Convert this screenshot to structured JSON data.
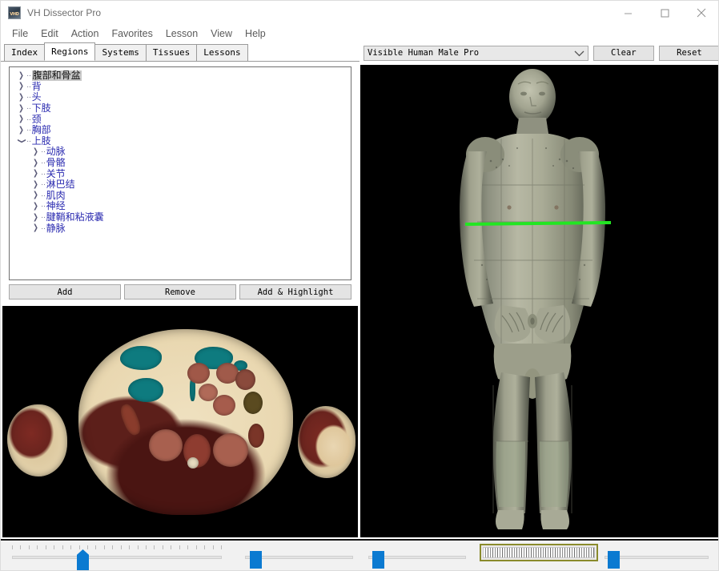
{
  "window": {
    "title": "VH Dissector Pro",
    "icon": "app-icon",
    "controls": {
      "minimize": "minimize-icon",
      "maximize": "maximize-icon",
      "close": "close-icon"
    }
  },
  "menubar": {
    "items": [
      {
        "label": "File"
      },
      {
        "label": "Edit"
      },
      {
        "label": "Action"
      },
      {
        "label": "Favorites"
      },
      {
        "label": "Lesson"
      },
      {
        "label": "View"
      },
      {
        "label": "Help"
      }
    ]
  },
  "tabs": {
    "active": "Regions",
    "items": [
      {
        "label": "Index"
      },
      {
        "label": "Regions"
      },
      {
        "label": "Systems"
      },
      {
        "label": "Tissues"
      },
      {
        "label": "Lessons"
      }
    ]
  },
  "tree": {
    "nodes": [
      {
        "label": "腹部和骨盆",
        "state": "collapsed",
        "level": 0,
        "selected": true
      },
      {
        "label": "背",
        "state": "collapsed",
        "level": 0,
        "selected": false
      },
      {
        "label": "头",
        "state": "collapsed",
        "level": 0,
        "selected": false
      },
      {
        "label": "下肢",
        "state": "collapsed",
        "level": 0,
        "selected": false
      },
      {
        "label": "颈",
        "state": "collapsed",
        "level": 0,
        "selected": false
      },
      {
        "label": "胸部",
        "state": "collapsed",
        "level": 0,
        "selected": false
      },
      {
        "label": "上肢",
        "state": "expanded",
        "level": 0,
        "selected": false
      },
      {
        "label": "动脉",
        "state": "collapsed",
        "level": 1,
        "selected": false
      },
      {
        "label": "骨骼",
        "state": "collapsed",
        "level": 1,
        "selected": false
      },
      {
        "label": "关节",
        "state": "collapsed",
        "level": 1,
        "selected": false
      },
      {
        "label": "淋巴结",
        "state": "collapsed",
        "level": 1,
        "selected": false
      },
      {
        "label": "肌肉",
        "state": "collapsed",
        "level": 1,
        "selected": false
      },
      {
        "label": "神经",
        "state": "collapsed",
        "level": 1,
        "selected": false
      },
      {
        "label": "腱鞘和粘液囊",
        "state": "collapsed",
        "level": 1,
        "selected": false
      },
      {
        "label": "静脉",
        "state": "collapsed",
        "level": 1,
        "selected": false
      }
    ]
  },
  "tree_buttons": {
    "add": "Add",
    "remove": "Remove",
    "add_highlight": "Add & Highlight"
  },
  "right_toolbar": {
    "dataset_combo": {
      "value": "Visible Human Male Pro",
      "arrow_icon": "chevron-down-icon"
    },
    "clear": "Clear",
    "reset": "Reset"
  },
  "viewers": {
    "slice_view": {
      "name": "axial-cross-section",
      "background": "#000000",
      "highlight_color": "#0e7b7f"
    },
    "model_view": {
      "name": "3d-body-model",
      "background": "#000000",
      "cut_plane_color": "#22e622"
    }
  },
  "sliders": [
    {
      "name": "slice-position-slider",
      "value_pct": 30,
      "ticks": 26,
      "thumb_style": "pointed"
    },
    {
      "name": "zoom-slider",
      "value_pct": 4,
      "ticks": 0,
      "thumb_style": "block"
    },
    {
      "name": "rotation-slider",
      "value_pct": 4,
      "ticks": 0,
      "thumb_style": "block"
    },
    {
      "name": "opacity-slider",
      "value_pct": 4,
      "ticks": 0,
      "thumb_style": "block"
    }
  ],
  "striped_control": {
    "name": "depth-range-control",
    "border_color": "#8a8b2c"
  },
  "colors": {
    "tree_text": "#2b2bb0",
    "selection_bg": "#c8c8c8",
    "slider_thumb": "#0b7ad1",
    "panel_bg": "#f1f1f1"
  }
}
